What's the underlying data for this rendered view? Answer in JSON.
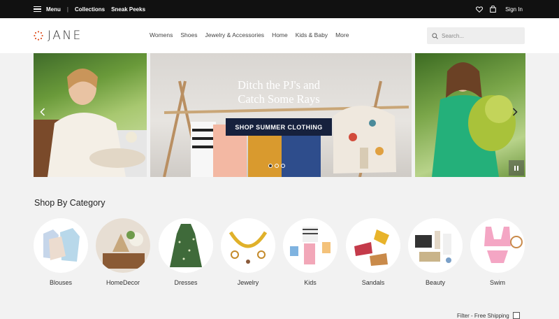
{
  "topbar": {
    "menu_label": "Menu",
    "separator": "|",
    "collections_label": "Collections",
    "sneak_peeks_label": "Sneak Peeks",
    "heart_icon": "heart-icon",
    "bag_icon": "bag-icon",
    "signin_label": "Sign In"
  },
  "header": {
    "logo_text": "JANE",
    "nav": [
      "Womens",
      "Shoes",
      "Jewelry & Accessories",
      "Home",
      "Kids & Baby",
      "More"
    ],
    "search_placeholder": "Search..."
  },
  "hero": {
    "heading_line1": "Ditch the PJ's and",
    "heading_line2": "Catch Some Rays",
    "cta_label": "SHOP SUMMER CLOTHING",
    "slides_total": 3,
    "active_slide": 1
  },
  "category": {
    "title": "Shop By Category",
    "items": [
      "Blouses",
      "HomeDecor",
      "Dresses",
      "Jewelry",
      "Kids",
      "Sandals",
      "Beauty",
      "Swim"
    ]
  },
  "footer_controls": {
    "filter_label": "Filter - Free Shipping"
  },
  "colors": {
    "topbar_bg": "#111111",
    "cta_bg": "#16213d",
    "logo_accent": "#e0582a",
    "page_bg": "#f2f2f2"
  }
}
